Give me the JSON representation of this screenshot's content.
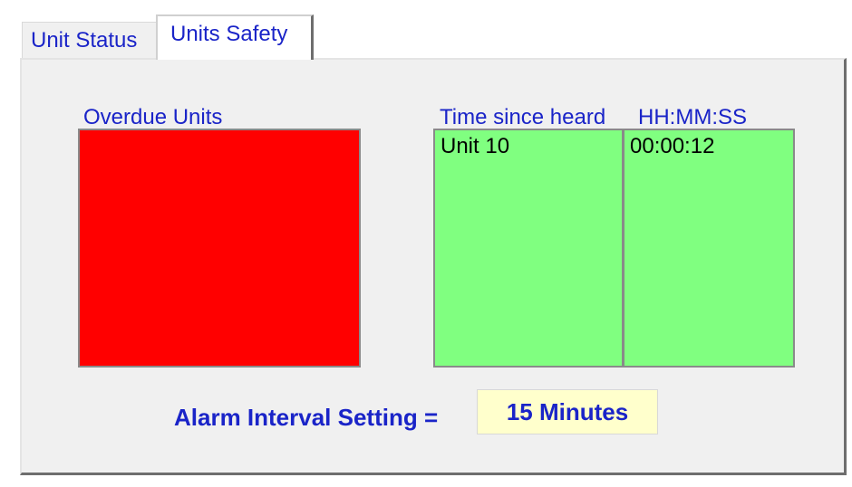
{
  "tabs": [
    {
      "label": "Unit Status",
      "active": false
    },
    {
      "label": "Units Safety",
      "active": true
    }
  ],
  "overdue": {
    "title": "Overdue Units",
    "color": "#ff0000",
    "items": []
  },
  "heard": {
    "title": "Time since heard",
    "time_format": "HH:MM:SS",
    "color": "#80ff80",
    "units": [
      "Unit 10"
    ],
    "times": [
      "00:00:12"
    ]
  },
  "alarm": {
    "label": "Alarm Interval Setting =",
    "value": "15 Minutes",
    "value_bg": "#ffffcc"
  },
  "colors": {
    "accent_text": "#1a24c8",
    "panel_bg": "#f0f0f0"
  }
}
